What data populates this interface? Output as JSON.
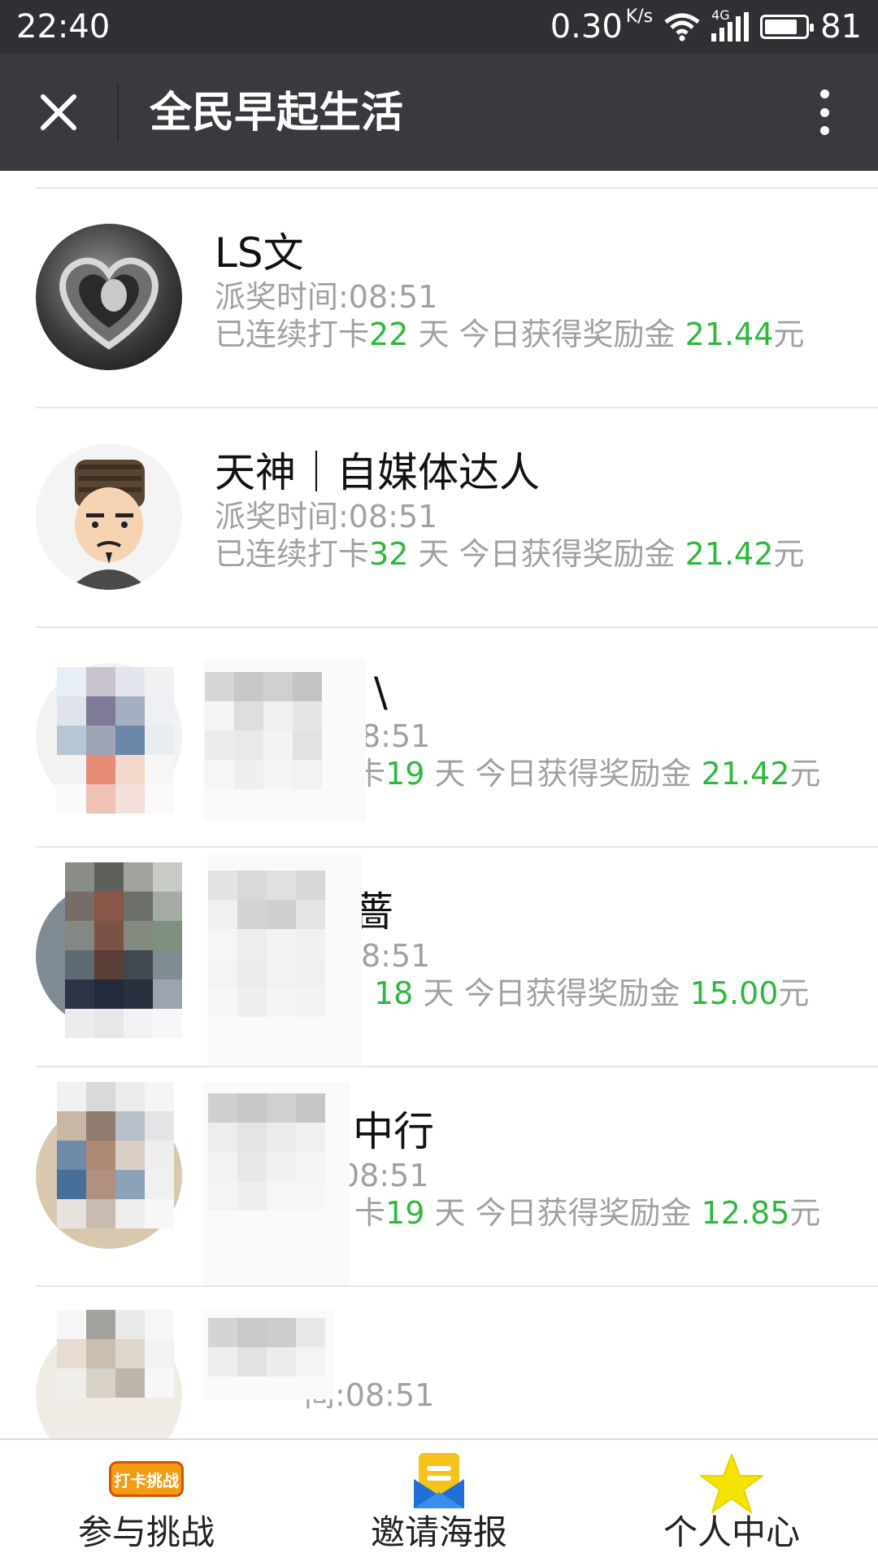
{
  "status_bar": {
    "time": "22:40",
    "network_speed": "0.30",
    "speed_unit": "K/s",
    "network_type": "4G",
    "battery": "81"
  },
  "title_bar": {
    "title": "全民早起生活"
  },
  "list": {
    "rows": [
      {
        "name": "LS文",
        "award_time": "派奖时间:08:51",
        "streak_prefix": "已连续打卡",
        "streak_days": "22",
        "streak_suffix": " 天 今日获得奖励金 ",
        "amount": "21.44",
        "currency": "元"
      },
      {
        "name": "天神｜自媒体达人",
        "award_time": "派奖时间:08:51",
        "streak_prefix": "已连续打卡",
        "streak_days": "32",
        "streak_suffix": " 天 今日获得奖励金 ",
        "amount": "21.42",
        "currency": "元"
      },
      {
        "name_partial": "\\",
        "award_time_partial": "8:51",
        "streak_prefix_partial": "卡",
        "streak_days": "19",
        "streak_suffix": " 天 今日获得奖励金 ",
        "amount": "21.42",
        "currency": "元"
      },
      {
        "name_partial": "蔷",
        "award_time_partial": "8:51",
        "streak_prefix_partial": "",
        "streak_days": "18",
        "streak_suffix": " 天 今日获得奖励金 ",
        "amount": "15.00",
        "currency": "元"
      },
      {
        "name_partial": "中行",
        "award_time_partial": "08:51",
        "streak_prefix_partial": "卡",
        "streak_days": "19",
        "streak_suffix": " 天 今日获得奖励金 ",
        "amount": "12.85",
        "currency": "元"
      },
      {
        "award_time_partial": "间:08:51"
      }
    ]
  },
  "bottom_nav": {
    "items": [
      {
        "label": "参与挑战",
        "icon": "checkin-challenge-icon",
        "icon_text": "打卡挑战"
      },
      {
        "label": "邀请海报",
        "icon": "invite-poster-icon"
      },
      {
        "label": "个人中心",
        "icon": "star-icon"
      }
    ]
  },
  "colors": {
    "status_bar": "#2e3033",
    "title_bar": "#393a3f",
    "accent_green": "#2db83d",
    "meta_gray": "#a0a0a0",
    "star_yellow": "#f5e400",
    "badge_orange": "#f39c12"
  }
}
